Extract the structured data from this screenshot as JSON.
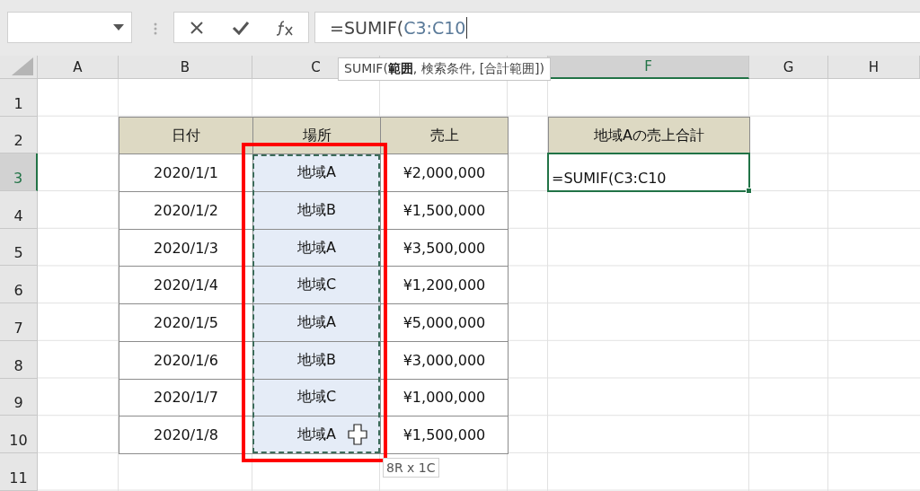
{
  "formula_bar": {
    "prefix": "=SUMIF(",
    "reference": "C3:C10",
    "editing": true
  },
  "function_tooltip": "SUMIF(**範囲**, 検索条件, [合計範囲])",
  "column_headers": [
    {
      "label": "A",
      "selected": false
    },
    {
      "label": "B",
      "selected": false
    },
    {
      "label": "C",
      "selected": false
    },
    {
      "selected": false
    },
    {
      "selected": false
    },
    {
      "label": "F",
      "selected": true
    },
    {
      "label": "G",
      "selected": false
    },
    {
      "label": "H",
      "selected": false
    }
  ],
  "row_headers": [
    {
      "label": "1",
      "selected": false
    },
    {
      "label": "2",
      "selected": false
    },
    {
      "label": "3",
      "selected": true
    },
    {
      "label": "4",
      "selected": false
    },
    {
      "label": "5",
      "selected": false
    },
    {
      "label": "6",
      "selected": false
    },
    {
      "label": "7",
      "selected": false
    },
    {
      "label": "8",
      "selected": false
    },
    {
      "label": "9",
      "selected": false
    },
    {
      "label": "10",
      "selected": false
    },
    {
      "label": "11",
      "selected": false
    }
  ],
  "table": {
    "columns": [
      {
        "label": "日付",
        "referenced": false
      },
      {
        "label": "場所",
        "referenced": true
      },
      {
        "label": "売上",
        "referenced": false
      }
    ],
    "rows": [
      [
        "2020/1/1",
        "地域A",
        "¥2,000,000"
      ],
      [
        "2020/1/2",
        "地域B",
        "¥1,500,000"
      ],
      [
        "2020/1/3",
        "地域A",
        "¥3,500,000"
      ],
      [
        "2020/1/4",
        "地域C",
        "¥1,200,000"
      ],
      [
        "2020/1/5",
        "地域A",
        "¥5,000,000"
      ],
      [
        "2020/1/6",
        "地域B",
        "¥3,000,000"
      ],
      [
        "2020/1/7",
        "地域C",
        "¥1,000,000"
      ],
      [
        "2020/1/8",
        "地域A",
        "¥1,500,000"
      ]
    ]
  },
  "summary": {
    "header": "地域Aの売上合計",
    "value": "=SUMIF(C3:C10",
    "editing": true
  },
  "range_size_tooltip": "8R x 1C"
}
